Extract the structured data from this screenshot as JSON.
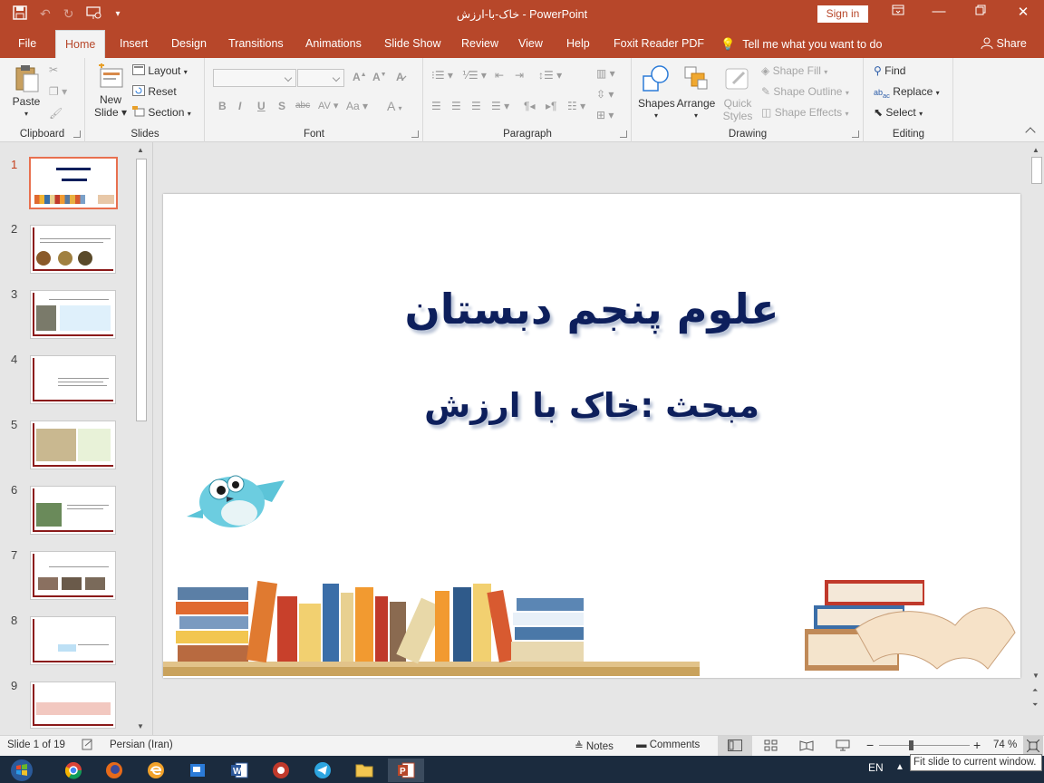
{
  "window": {
    "title": "خاک-با-ارزش  -  PowerPoint",
    "sign_in": "Sign in"
  },
  "tabs": [
    "File",
    "Home",
    "Insert",
    "Design",
    "Transitions",
    "Animations",
    "Slide Show",
    "Review",
    "View",
    "Help",
    "Foxit Reader PDF"
  ],
  "tell_me": "Tell me what you want to do",
  "share": "Share",
  "ribbon": {
    "clipboard": {
      "label": "Clipboard",
      "paste": "Paste"
    },
    "slides": {
      "label": "Slides",
      "new_slide_line1": "New",
      "new_slide_line2": "Slide",
      "layout": "Layout",
      "reset": "Reset",
      "section": "Section"
    },
    "font": {
      "label": "Font"
    },
    "paragraph": {
      "label": "Paragraph"
    },
    "drawing": {
      "label": "Drawing",
      "shapes": "Shapes",
      "arrange": "Arrange",
      "quick_styles_line1": "Quick",
      "quick_styles_line2": "Styles",
      "shape_fill": "Shape Fill",
      "shape_outline": "Shape Outline",
      "shape_effects": "Shape Effects"
    },
    "editing": {
      "label": "Editing",
      "find": "Find",
      "replace": "Replace",
      "select": "Select"
    }
  },
  "thumbnails": [
    {
      "num": "1",
      "selected": true
    },
    {
      "num": "2"
    },
    {
      "num": "3"
    },
    {
      "num": "4"
    },
    {
      "num": "5"
    },
    {
      "num": "6"
    },
    {
      "num": "7"
    },
    {
      "num": "8"
    },
    {
      "num": "9"
    }
  ],
  "slide": {
    "title": "علوم پنجم دبستان",
    "subtitle": "مبحث :خاک با ارزش"
  },
  "status": {
    "slide_of": "Slide 1 of 19",
    "language": "Persian (Iran)",
    "notes": "Notes",
    "comments": "Comments",
    "zoom": "74 %"
  },
  "taskbar": {
    "lang": "EN"
  },
  "tooltip": "Fit slide to current window.",
  "colors": {
    "accent": "#b7472a",
    "slide_text": "#0d1f5c",
    "selected_thumb": "#e8704f"
  }
}
